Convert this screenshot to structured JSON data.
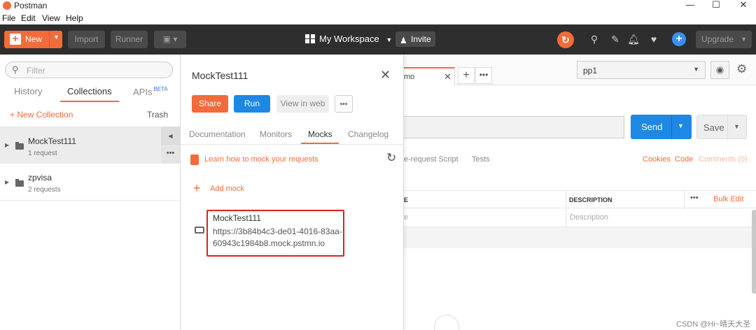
{
  "window": {
    "title": "Postman",
    "minimize": "—",
    "maximize": "☐",
    "close": "✕"
  },
  "menu": [
    "File",
    "Edit",
    "View",
    "Help"
  ],
  "toolbar": {
    "new_label": "New",
    "import_label": "Import",
    "runner_label": "Runner",
    "workspace_label": "My Workspace",
    "invite_label": "Invite",
    "upgrade_label": "Upgrade"
  },
  "sidebar": {
    "filter_placeholder": "Filter",
    "tabs": [
      "History",
      "Collections",
      "APIs"
    ],
    "beta": "BETA",
    "new_collection": "New Collection",
    "trash": "Trash",
    "collections": [
      {
        "name": "MockTest111",
        "count": "1 request"
      },
      {
        "name": "zpvisa",
        "count": "2 requests"
      }
    ]
  },
  "panel": {
    "title": "MockTest111",
    "share_label": "Share",
    "run_label": "Run",
    "view_web_label": "View in web",
    "more_label": "•••",
    "tabs": [
      "Documentation",
      "Monitors",
      "Mocks",
      "Changelog"
    ],
    "learn_link": "Learn how to mock your requests",
    "add_mock": "Add mock",
    "mock": {
      "name": "MockTest111",
      "url": "https://3b84b4c3-de01-4016-83aa-60943c1984b8.mock.pstmn.io"
    }
  },
  "main": {
    "tab_title": "mo",
    "environment": "pp1",
    "send_label": "Send",
    "save_label": "Save",
    "request_tabs": [
      "e-request Script",
      "Tests"
    ],
    "links": {
      "cookies": "Cookies",
      "code": "Code",
      "comments": "Comments (0)"
    },
    "table": {
      "headers": [
        "E",
        "DESCRIPTION"
      ],
      "row_placeholders": [
        "e",
        "Description"
      ],
      "bulk_edit": "Bulk Edit",
      "more": "•••"
    }
  },
  "watermark": "CSDN @Hi~晴天大圣",
  "colors": {
    "accent": "#f26b3a",
    "primary": "#1e88e5",
    "toolbar": "#2e2e2e",
    "highlight": "#e02020"
  }
}
